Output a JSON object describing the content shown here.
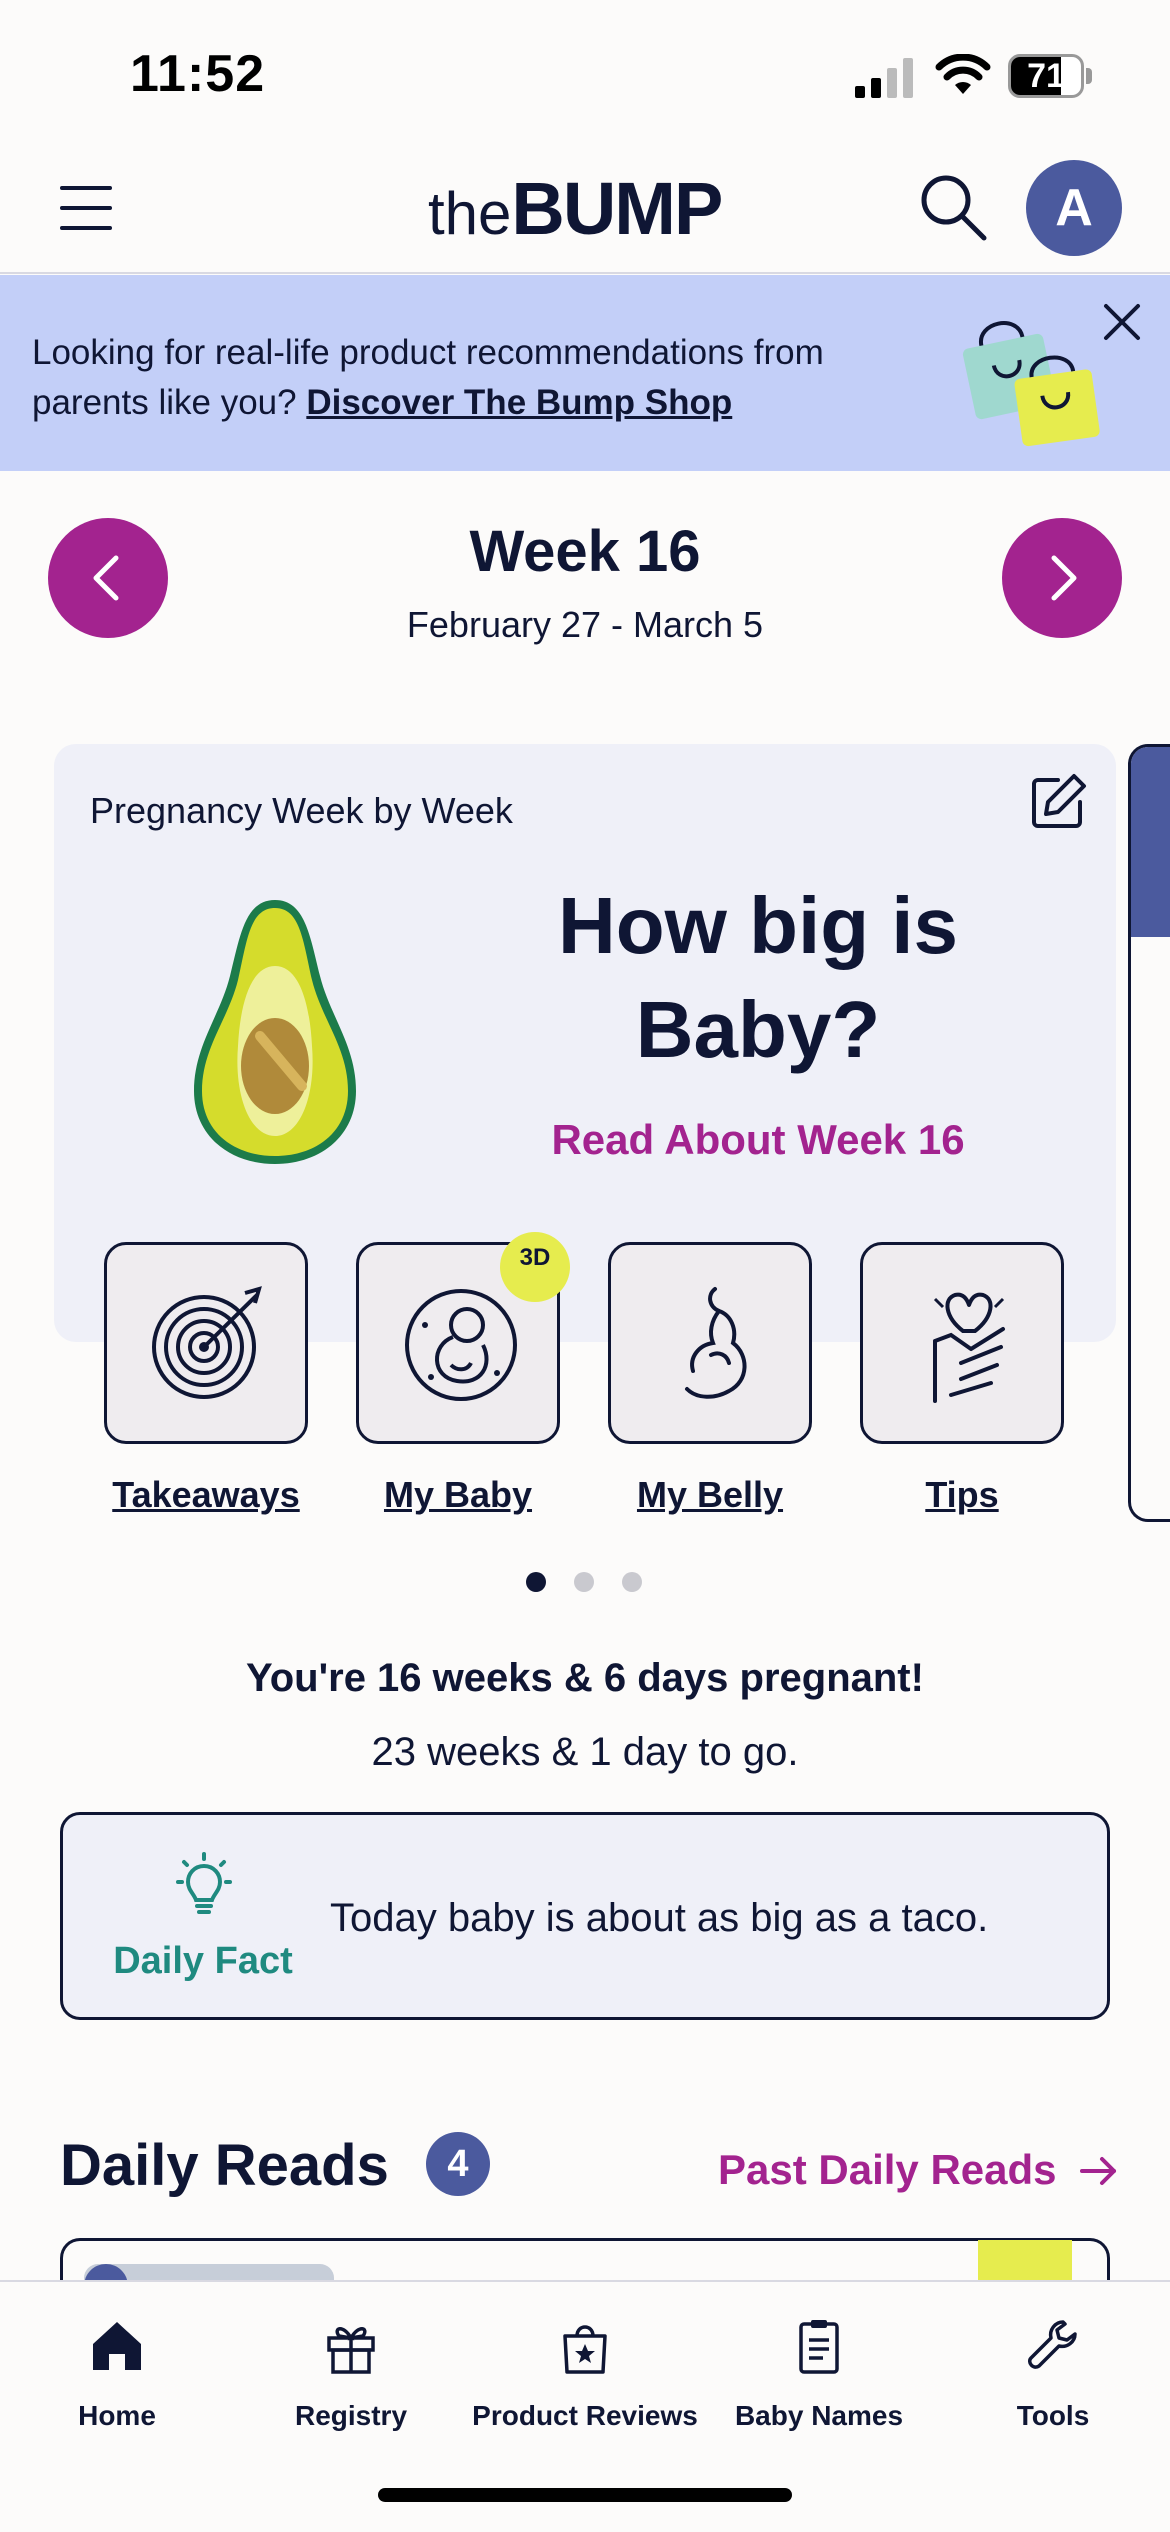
{
  "status_bar": {
    "time": "11:52",
    "battery": "71",
    "battery_level": 0.71,
    "icons": [
      "signal-icon",
      "wifi-icon",
      "battery-icon"
    ]
  },
  "header": {
    "logo_the": "the",
    "logo_bump": "BUMP",
    "avatar_initial": "A",
    "icons": [
      "menu-icon",
      "search-icon"
    ]
  },
  "banner": {
    "text": "Looking for real-life product recommendations from parents like you?",
    "link": "Discover The Bump Shop",
    "close_icon": "close-icon"
  },
  "week": {
    "title": "Week 16",
    "dates": "February 27 - March 5"
  },
  "card": {
    "label": "Pregnancy Week by Week",
    "heading_line1": "How big is",
    "heading_line2": "Baby?",
    "link": "Read About Week 16",
    "badge": "3D",
    "tiles": [
      {
        "label": "Takeaways",
        "icon": "target-icon"
      },
      {
        "label": "My Baby",
        "icon": "baby-fetus-icon"
      },
      {
        "label": "My Belly",
        "icon": "pregnant-belly-icon"
      },
      {
        "label": "Tips",
        "icon": "heart-hand-icon"
      }
    ],
    "pagination": {
      "count": 3,
      "active": 0
    }
  },
  "progress": {
    "pregnant": "You're 16 weeks & 6 days pregnant!",
    "to_go": "23 weeks & 1 day to go."
  },
  "daily_fact": {
    "label": "Daily Fact",
    "text": "Today baby is about as big as a taco."
  },
  "daily_reads": {
    "title": "Daily Reads",
    "count": "4",
    "past_link": "Past Daily Reads"
  },
  "tabs": [
    {
      "label": "Home",
      "icon": "home-icon",
      "active": true
    },
    {
      "label": "Registry",
      "icon": "gift-icon"
    },
    {
      "label": "Product Reviews",
      "icon": "review-bag-icon"
    },
    {
      "label": "Baby Names",
      "icon": "clipboard-icon"
    },
    {
      "label": "Tools",
      "icon": "wrench-icon"
    }
  ],
  "colors": {
    "navy": "#0f1634",
    "magenta": "#a3238f",
    "banner_bg": "#c3cff8",
    "card_bg": "#eff0f8",
    "teal": "#1f8a80",
    "accent_yellow": "#e6ec4e",
    "avatar_blue": "#4b5a9e"
  }
}
